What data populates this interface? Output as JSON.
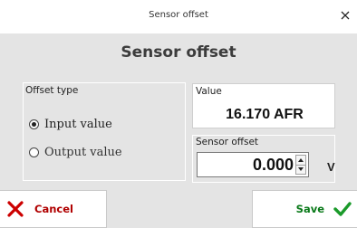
{
  "window": {
    "title": "Sensor offset",
    "close_glyph": "✕"
  },
  "heading": "Sensor offset",
  "offset_type": {
    "label": "Offset type",
    "options": [
      {
        "label": "Input value",
        "selected": true
      },
      {
        "label": "Output value",
        "selected": false
      }
    ]
  },
  "value": {
    "label": "Value",
    "text": "16.170 AFR"
  },
  "sensor_offset": {
    "label": "Sensor offset",
    "value": "0.000",
    "unit": "V"
  },
  "buttons": {
    "cancel": {
      "label": "Cancel",
      "icon": "x-icon",
      "color": "#cc0000"
    },
    "save": {
      "label": "Save",
      "icon": "check-icon",
      "color": "#1a9a2a"
    }
  },
  "colors": {
    "content_bg": "#e4e4e4",
    "cancel_text": "#b00000",
    "save_text": "#0a7a1a"
  }
}
